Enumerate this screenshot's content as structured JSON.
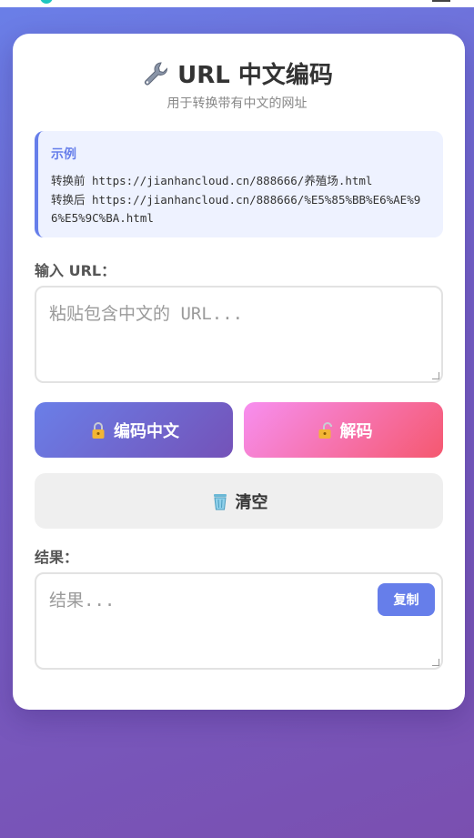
{
  "app": {
    "title": "URL 中文编码",
    "subtitle": "用于转换带有中文的网址"
  },
  "example": {
    "heading": "示例",
    "before": "转换前 https://jianhancloud.cn/888666/养殖场.html",
    "after": "转换后 https://jianhancloud.cn/888666/%E5%85%BB%E6%AE%96%E5%9C%BA.html"
  },
  "input": {
    "label": "输入 URL：",
    "placeholder": "粘贴包含中文的 URL...",
    "value": ""
  },
  "buttons": {
    "encode_label": "编码中文",
    "decode_label": "解码",
    "clear_label": "清空",
    "copy_label": "复制"
  },
  "result": {
    "label": "结果：",
    "placeholder": "结果...",
    "value": ""
  },
  "icons": {
    "title_icon": "wrench-icon",
    "encode_icon": "lock-icon",
    "decode_icon": "unlock-icon",
    "clear_icon": "trash-icon"
  },
  "colors": {
    "accent": "#667eea",
    "encode_gradient": [
      "#6a7fe8",
      "#7452b8"
    ],
    "decode_gradient": [
      "#f78ff0",
      "#f5586f"
    ],
    "background_gradient": [
      "#6a7fe8",
      "#7a4fb0"
    ]
  }
}
